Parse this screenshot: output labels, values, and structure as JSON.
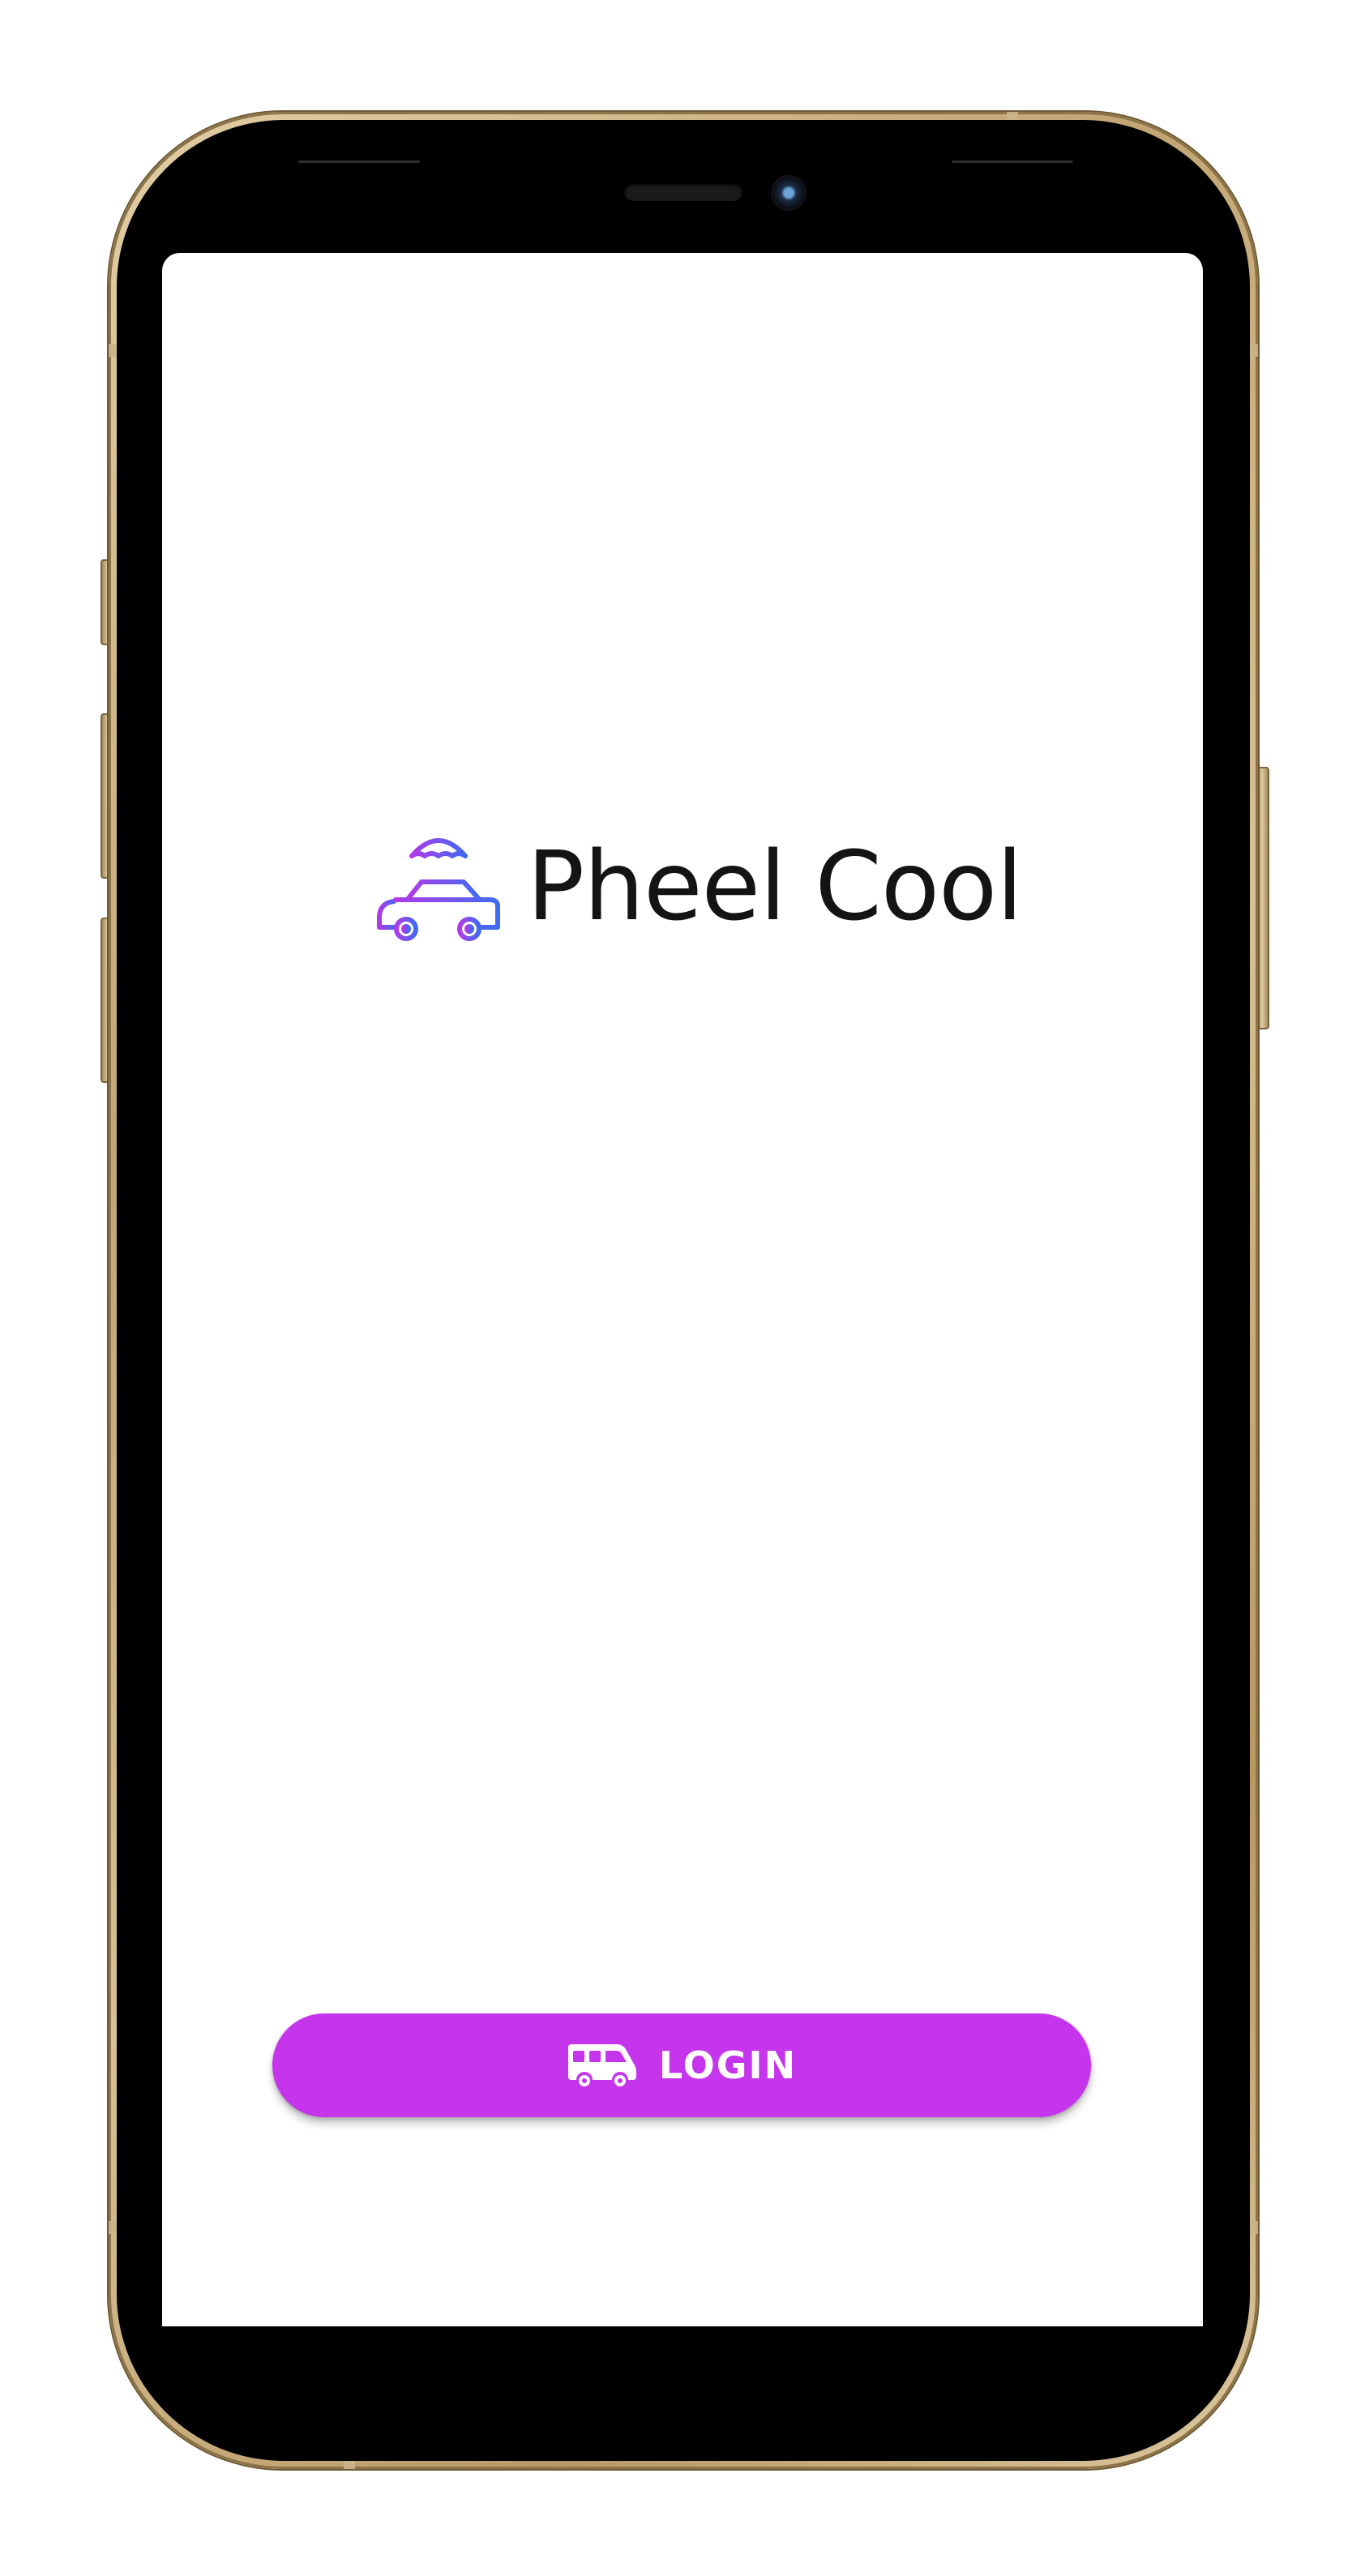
{
  "app": {
    "brand_name": "Pheel Cool",
    "logo_icon": "car-umbrella-icon",
    "accent_color": "#c535ec",
    "logo_gradient": [
      "#b03ae8",
      "#3f6bf2"
    ]
  },
  "login_button": {
    "label": "LOGIN",
    "icon": "van-icon"
  },
  "device": {
    "frame_color": "#c9ae7e"
  }
}
